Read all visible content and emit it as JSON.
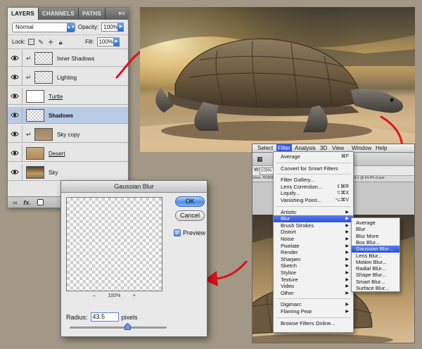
{
  "colors": {
    "accent_red": "#d8141c",
    "menu_highlight": "#3b5bdb",
    "selected_layer": "#b8cbe7"
  },
  "layers_panel": {
    "tabs": [
      "LAYERS",
      "CHANNELS",
      "PATHS"
    ],
    "menu_icon": "panel-menu-icon",
    "blend_mode": "Normal",
    "opacity_label": "Opacity:",
    "opacity_value": "100%",
    "lock_label": "Lock:",
    "fill_label": "Fill:",
    "fill_value": "100%",
    "layers": [
      {
        "name": "Inner Shadows",
        "style": "normal",
        "clipped": true,
        "selected": false
      },
      {
        "name": "Lighting",
        "style": "normal",
        "clipped": true,
        "selected": false
      },
      {
        "name": "Turtle",
        "style": "underline",
        "clipped": false,
        "selected": false
      },
      {
        "name": "Shadows",
        "style": "bold",
        "clipped": false,
        "selected": true
      },
      {
        "name": "Sky copy",
        "style": "normal",
        "clipped": true,
        "selected": false
      },
      {
        "name": "Desert",
        "style": "underline",
        "clipped": false,
        "selected": false
      },
      {
        "name": "Sky",
        "style": "normal",
        "clipped": false,
        "selected": false
      }
    ],
    "bottom_icons": [
      "link-icon",
      "fx-icon",
      "mask-icon"
    ],
    "fx_label": "fx."
  },
  "photoshop_window": {
    "menu": [
      "Select",
      "Filter",
      "Analysis",
      "3D",
      "View",
      "Window",
      "Help"
    ],
    "active_menu": "Filter",
    "zoom_value": "100%",
    "doc_tab_text": "dows, RGB/8*)     ×    Untitled-1 @ 64.4% (Layer 2, RGB/8*)  ⊗ Untitled-1 @ 64.4% (Laye"
  },
  "filter_menu": {
    "items": [
      {
        "label": "Average",
        "shortcut": "⌘F"
      },
      {
        "separator": true
      },
      {
        "label": "Convert for Smart Filters"
      },
      {
        "separator": true
      },
      {
        "label": "Filter Gallery..."
      },
      {
        "label": "Lens Correction...",
        "shortcut": "⇧⌘R"
      },
      {
        "label": "Liquify...",
        "shortcut": "⇧⌘X"
      },
      {
        "label": "Vanishing Point...",
        "shortcut": "⌥⌘V"
      },
      {
        "separator": true
      },
      {
        "label": "Artistic",
        "submenu": true
      },
      {
        "label": "Blur",
        "submenu": true,
        "highlighted": true
      },
      {
        "label": "Brush Strokes",
        "submenu": true
      },
      {
        "label": "Distort",
        "submenu": true
      },
      {
        "label": "Noise",
        "submenu": true
      },
      {
        "label": "Pixelate",
        "submenu": true
      },
      {
        "label": "Render",
        "submenu": true
      },
      {
        "label": "Sharpen",
        "submenu": true
      },
      {
        "label": "Sketch",
        "submenu": true
      },
      {
        "label": "Stylize",
        "submenu": true
      },
      {
        "label": "Texture",
        "submenu": true
      },
      {
        "label": "Video",
        "submenu": true
      },
      {
        "label": "Other",
        "submenu": true
      },
      {
        "separator": true
      },
      {
        "label": "Digimarc",
        "submenu": true
      },
      {
        "label": "Flaming Pear",
        "submenu": true
      },
      {
        "separator": true
      },
      {
        "label": "Browse Filters Online..."
      }
    ]
  },
  "blur_submenu": {
    "items": [
      {
        "label": "Average"
      },
      {
        "label": "Blur"
      },
      {
        "label": "Blur More"
      },
      {
        "label": "Box Blur..."
      },
      {
        "label": "Gaussian Blur...",
        "highlighted": true
      },
      {
        "label": "Lens Blur..."
      },
      {
        "label": "Motion Blur..."
      },
      {
        "label": "Radial Blur..."
      },
      {
        "label": "Shape Blur..."
      },
      {
        "label": "Smart Blur..."
      },
      {
        "label": "Surface Blur..."
      }
    ]
  },
  "gaussian_blur": {
    "title": "Gaussian Blur",
    "ok_label": "OK",
    "cancel_label": "Cancel",
    "preview_label": "Preview",
    "preview_checked": true,
    "zoom_minus": "–",
    "zoom_value": "100%",
    "zoom_plus": "+",
    "radius_label": "Radius:",
    "radius_value": "43.5",
    "radius_unit": "pixels",
    "slider_fraction": 0.6
  }
}
